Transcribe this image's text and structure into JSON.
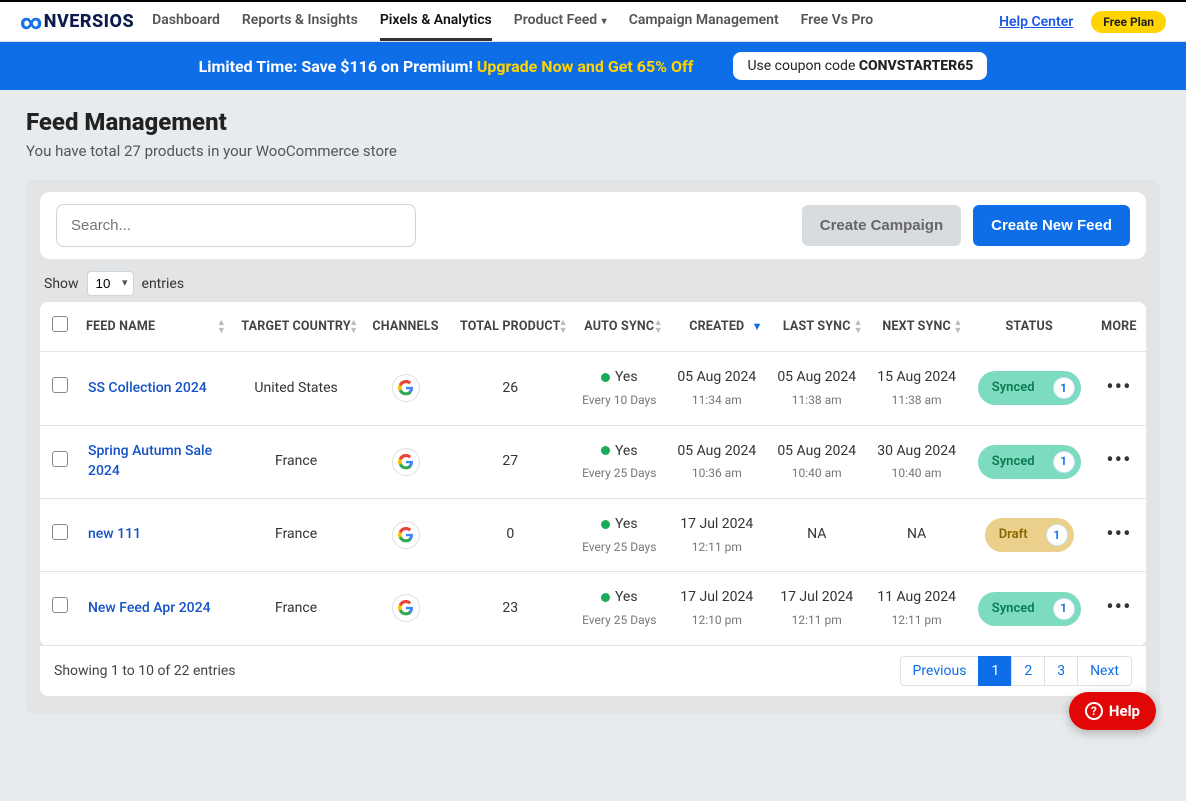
{
  "nav": {
    "items": [
      "Dashboard",
      "Reports & Insights",
      "Pixels & Analytics",
      "Product Feed",
      "Campaign Management",
      "Free Vs Pro"
    ],
    "help": "Help Center",
    "plan": "Free Plan"
  },
  "promo": {
    "lead": "Limited Time: Save $116 on Premium!",
    "cta": "Upgrade Now and Get 65% Off",
    "coupon_lead": "Use coupon code ",
    "coupon_code": "CONVSTARTER65"
  },
  "page": {
    "title": "Feed Management",
    "subtitle": "You have total 27 products in your WooCommerce store"
  },
  "toolbar": {
    "search_placeholder": "Search...",
    "create_campaign": "Create Campaign",
    "create_feed": "Create New Feed"
  },
  "length": {
    "show": "Show",
    "value": "10",
    "entries": "entries"
  },
  "columns": {
    "feed": "FEED NAME",
    "country": "TARGET COUNTRY",
    "channels": "CHANNELS",
    "total": "TOTAL PRODUCT",
    "auto": "AUTO SYNC",
    "created": "CREATED",
    "last": "LAST SYNC",
    "next": "NEXT SYNC",
    "status": "STATUS",
    "more": "MORE"
  },
  "rows": [
    {
      "name": "SS Collection 2024",
      "country": "United States",
      "total": "26",
      "auto_text": "Yes",
      "auto_sub": "Every 10 Days",
      "created": "05 Aug 2024",
      "created_t": "11:34 am",
      "last": "05 Aug 2024",
      "last_t": "11:38 am",
      "next": "15 Aug 2024",
      "next_t": "11:38 am",
      "status": "Synced",
      "status_type": "synced",
      "count": "1"
    },
    {
      "name": "Spring Autumn Sale 2024",
      "country": "France",
      "total": "27",
      "auto_text": "Yes",
      "auto_sub": "Every 25 Days",
      "created": "05 Aug 2024",
      "created_t": "10:36 am",
      "last": "05 Aug 2024",
      "last_t": "10:40 am",
      "next": "30 Aug 2024",
      "next_t": "10:40 am",
      "status": "Synced",
      "status_type": "synced",
      "count": "1"
    },
    {
      "name": "new 111",
      "country": "France",
      "total": "0",
      "auto_text": "Yes",
      "auto_sub": "Every 25 Days",
      "created": "17 Jul 2024",
      "created_t": "12:11 pm",
      "last": "NA",
      "last_t": "",
      "next": "NA",
      "next_t": "",
      "status": "Draft",
      "status_type": "draft",
      "count": "1"
    },
    {
      "name": "New Feed Apr 2024",
      "country": "France",
      "total": "23",
      "auto_text": "Yes",
      "auto_sub": "Every 25 Days",
      "created": "17 Jul 2024",
      "created_t": "12:10 pm",
      "last": "17 Jul 2024",
      "last_t": "12:11 pm",
      "next": "11 Aug 2024",
      "next_t": "12:11 pm",
      "status": "Synced",
      "status_type": "synced",
      "count": "1"
    }
  ],
  "footer": {
    "info": "Showing 1 to 10 of 22 entries",
    "pager": {
      "prev": "Previous",
      "p1": "1",
      "p2": "2",
      "p3": "3",
      "next": "Next"
    }
  },
  "help_fab": "Help"
}
